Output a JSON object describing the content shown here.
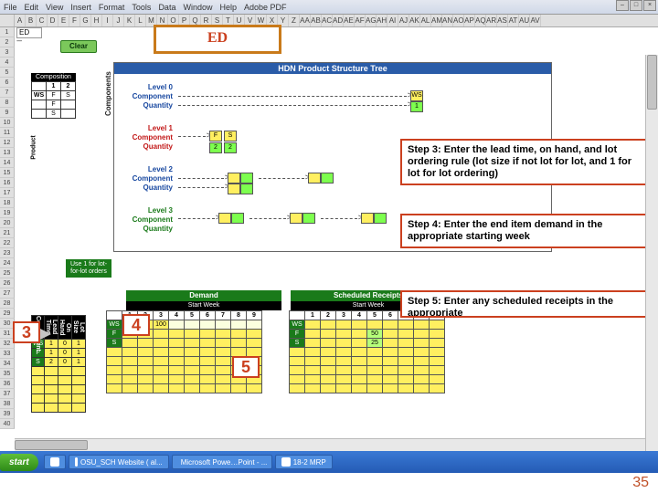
{
  "menu": {
    "items": [
      "File",
      "Edit",
      "View",
      "Insert",
      "Format",
      "Tools",
      "Data",
      "Window",
      "Help",
      "Adobe PDF"
    ]
  },
  "window_controls": [
    "–",
    "□",
    "×"
  ],
  "columns": [
    "A",
    "B",
    "C",
    "D",
    "E",
    "F",
    "G",
    "H",
    "I",
    "J",
    "K",
    "L",
    "M",
    "N",
    "O",
    "P",
    "Q",
    "R",
    "S",
    "T",
    "U",
    "V",
    "W",
    "X",
    "Y",
    "Z",
    "AA",
    "AB",
    "AC",
    "AD",
    "AE",
    "AF",
    "AG",
    "AH",
    "AI",
    "AJ",
    "AK",
    "AL",
    "AM",
    "AN",
    "AO",
    "AP",
    "AQ",
    "AR",
    "AS",
    "AT",
    "AU",
    "AV"
  ],
  "cell_a1": "ED",
  "cell_a2": "----",
  "clear_label": "Clear",
  "ed_banner": "ED",
  "chart": {
    "title": "HDN Product Structure Tree",
    "axis_product": "Product",
    "axis_components": "Components",
    "levels": [
      {
        "name": "Level 0",
        "sub": "Component",
        "sub2": "Quantity",
        "color": "lvl-blue"
      },
      {
        "name": "Level 1",
        "sub": "Component",
        "sub2": "Quantity",
        "color": "lvl-red"
      },
      {
        "name": "Level 2",
        "sub": "Component",
        "sub2": "Quantity",
        "color": "lvl-blue"
      },
      {
        "name": "Level 3",
        "sub": "Component",
        "sub2": "Quantity",
        "color": "lvl-green"
      }
    ],
    "top_node": {
      "label": "WS",
      "qty": "1"
    },
    "l1_nodes": [
      {
        "label": "F",
        "qty": "2"
      },
      {
        "label": "S",
        "qty": "2"
      }
    ]
  },
  "mini_table": {
    "hdr": "Composition",
    "cols": [
      "1",
      "2"
    ],
    "row_head": "Product",
    "rows": [
      [
        "WS",
        "F",
        "S"
      ],
      [
        "",
        "F",
        ""
      ],
      [
        "",
        "S",
        ""
      ]
    ]
  },
  "lot_note": "Use 1 for lot-for-lot orders",
  "sidebar": {
    "headers": [
      "Component",
      "Lead Time",
      "On Hand",
      "Lot Size"
    ],
    "rows": [
      {
        "c": "WS",
        "lt": "1",
        "oh": "0",
        "ls": "1"
      },
      {
        "c": "F",
        "lt": "1",
        "oh": "0",
        "ls": "1"
      },
      {
        "c": "S",
        "lt": "2",
        "oh": "0",
        "ls": "1"
      }
    ]
  },
  "sections": {
    "demand": "Demand",
    "demand_sub": "Start Week",
    "sched": "Scheduled Receipts",
    "sched_sub": "Start Week"
  },
  "week_headers": [
    "",
    "1",
    "2",
    "3",
    "4",
    "5",
    "6",
    "7",
    "8",
    "9"
  ],
  "demand_rows": [
    {
      "c": "WS",
      "vals": [
        "",
        "",
        "100",
        "",
        "",
        "",
        "",
        "",
        ""
      ]
    },
    {
      "c": "F",
      "vals": [
        "",
        "",
        "",
        "",
        "",
        "",
        "",
        "",
        ""
      ]
    },
    {
      "c": "S",
      "vals": [
        "",
        "",
        "",
        "",
        "",
        "",
        "",
        "",
        ""
      ]
    }
  ],
  "sched_rows": [
    {
      "c": "WS",
      "vals": [
        "",
        "",
        "",
        "",
        "",
        "",
        "",
        "",
        ""
      ]
    },
    {
      "c": "F",
      "vals": [
        "",
        "",
        "",
        "",
        "50",
        "",
        "",
        "",
        ""
      ]
    },
    {
      "c": "S",
      "vals": [
        "",
        "",
        "",
        "",
        "25",
        "",
        "",
        "",
        ""
      ]
    }
  ],
  "callouts": {
    "c3": "3",
    "c4": "4",
    "c5": "5"
  },
  "steps": {
    "s3": "Step 3: Enter the lead time, on hand, and lot ordering rule (lot size  if not lot for lot, and 1 for lot for lot ordering)",
    "s4": "Step 4: Enter the end item demand in the appropriate starting week",
    "s5": "Step 5: Enter any scheduled receipts in the appropriate"
  },
  "taskbar": {
    "start": "start",
    "items": [
      "",
      "OSU_SCH Website ( al...",
      "Microsoft Powe…Point - ...",
      "18-2 MRP"
    ]
  },
  "slide_num": "35"
}
